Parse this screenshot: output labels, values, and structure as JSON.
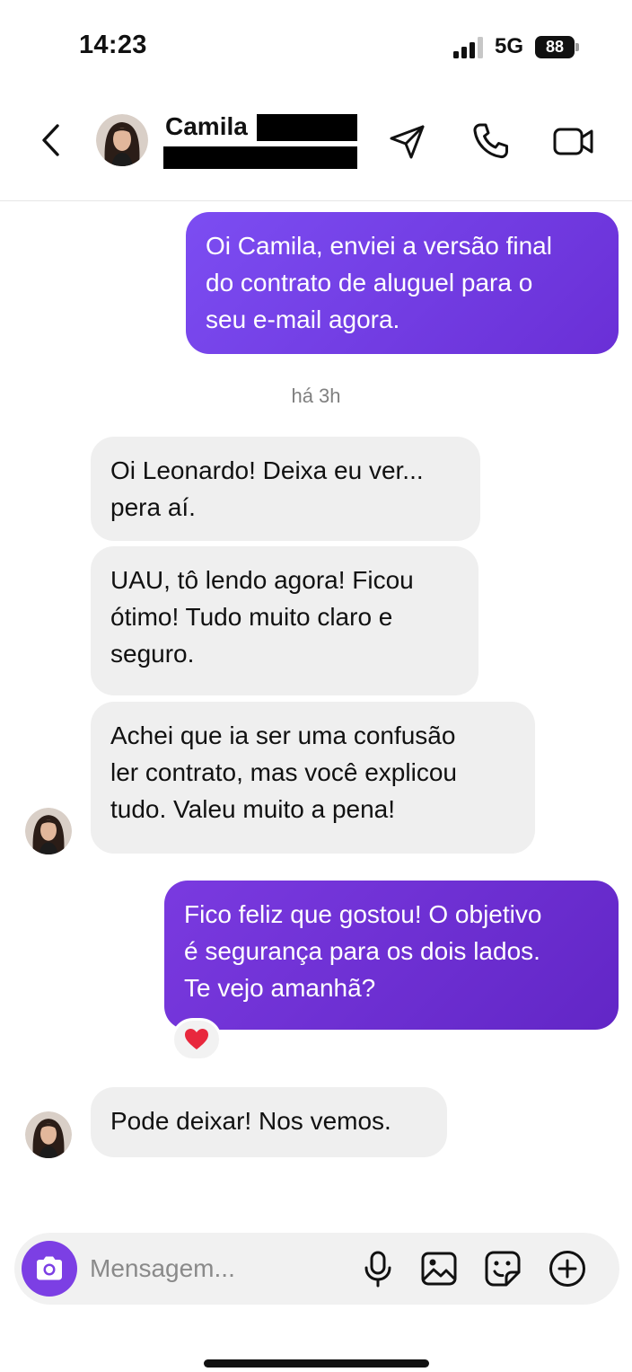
{
  "status_bar": {
    "time": "14:23",
    "network": "5G",
    "battery": "88"
  },
  "header": {
    "contact_first_name": "Camila",
    "back_icon": "chevron-left-icon",
    "actions": [
      "send-icon",
      "phone-icon",
      "video-icon"
    ]
  },
  "conversation": {
    "msg1_lines": [
      "Oi Camila, enviei a versão final",
      "do contrato de aluguel para o",
      "seu e-mail agora."
    ],
    "timestamp": "há 3h",
    "msg2_lines": [
      "Oi Leonardo! Deixa eu ver...",
      "pera aí."
    ],
    "msg3_lines": [
      "UAU, tô lendo agora! Ficou",
      "ótimo! Tudo muito claro e",
      "seguro."
    ],
    "msg4_lines": [
      "Achei que ia ser uma confusão",
      "ler contrato, mas você explicou",
      "tudo. Valeu muito a pena!"
    ],
    "msg5_lines": [
      "Fico feliz que gostou! O objetivo",
      "é segurança para os dois lados.",
      "Te vejo amanhã?"
    ],
    "msg5_reaction": "heart",
    "msg6_lines": [
      "Pode deixar! Nos vemos."
    ]
  },
  "composer": {
    "placeholder": "Mensagem...",
    "icons": [
      "camera-icon",
      "microphone-icon",
      "image-icon",
      "sticker-icon",
      "plus-icon"
    ]
  },
  "colors": {
    "accent": "#7c3fe4",
    "received_bubble": "#efefef"
  }
}
